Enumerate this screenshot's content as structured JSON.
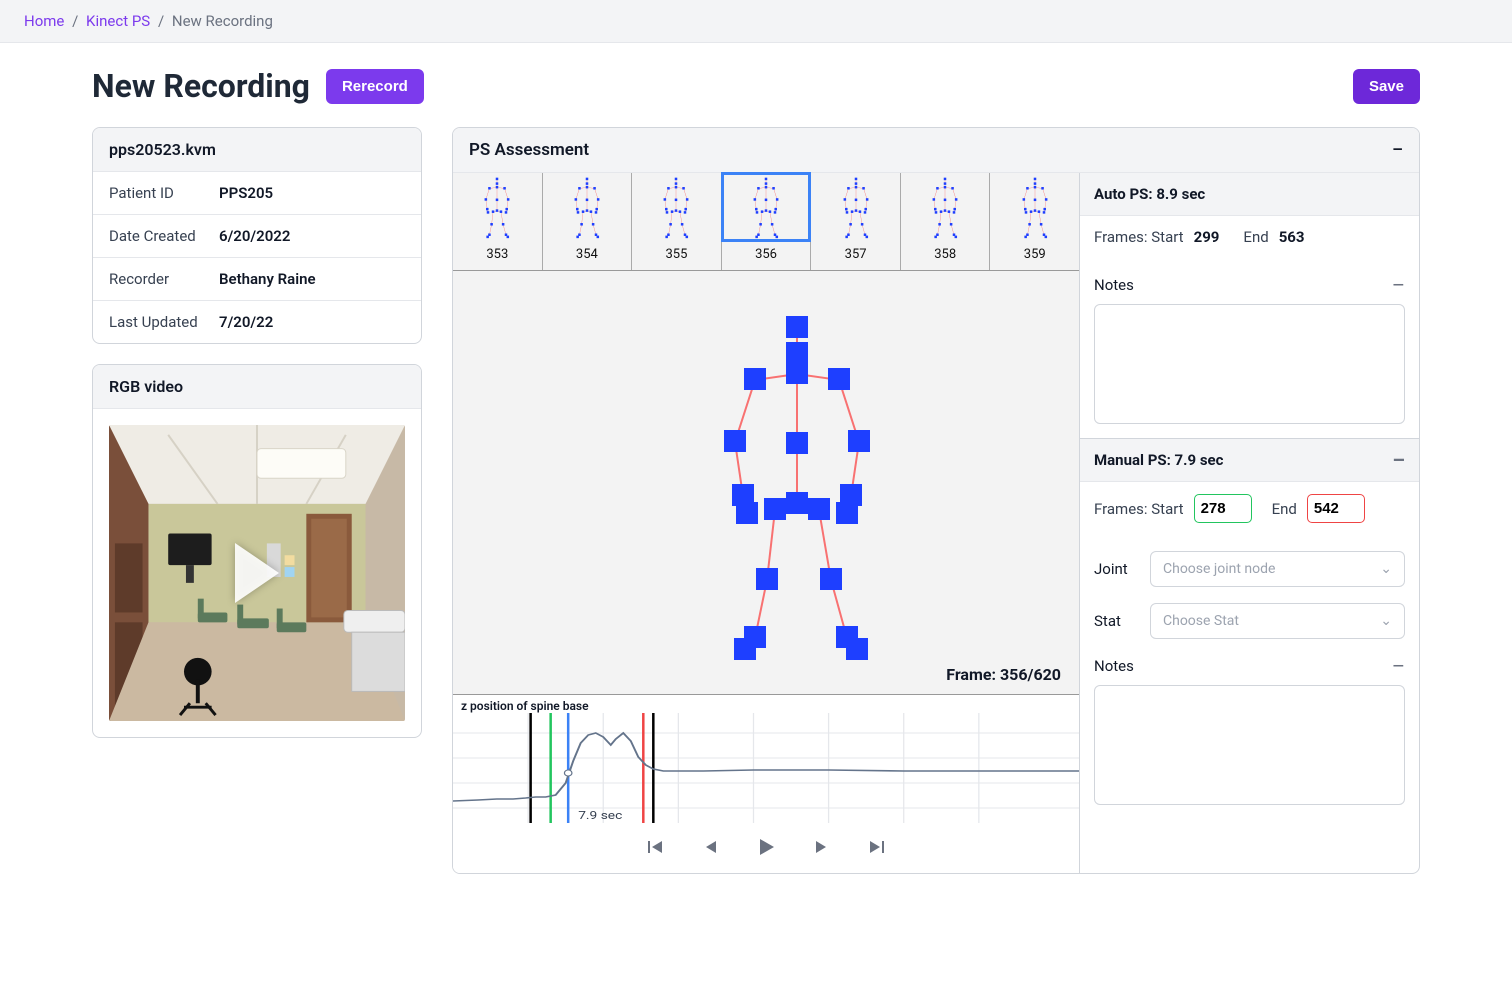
{
  "breadcrumb": {
    "home": "Home",
    "section": "Kinect PS",
    "current": "New Recording"
  },
  "page": {
    "title": "New Recording",
    "rerecord_label": "Rerecord",
    "save_label": "Save"
  },
  "file_card": {
    "filename": "pps20523.kvm",
    "rows": [
      {
        "label": "Patient ID",
        "value": "PPS205"
      },
      {
        "label": "Date Created",
        "value": "6/20/2022"
      },
      {
        "label": "Recorder",
        "value": "Bethany Raine"
      },
      {
        "label": "Last Updated",
        "value": "7/20/22"
      }
    ]
  },
  "video_card": {
    "title": "RGB video"
  },
  "assessment": {
    "title": "PS Assessment",
    "frames": [
      "353",
      "354",
      "355",
      "356",
      "357",
      "358",
      "359"
    ],
    "selected_index": 3,
    "current_frame_label": "Frame: 356/620",
    "plot_title": "z position of spine base",
    "duration_label": "7.9 sec"
  },
  "auto_panel": {
    "title": "Auto PS: 8.9 sec",
    "frames_label": "Frames: Start",
    "start": "299",
    "end_label": "End",
    "end": "563",
    "notes_label": "Notes"
  },
  "manual_panel": {
    "title": "Manual PS: 7.9 sec",
    "frames_label": "Frames: Start",
    "start": "278",
    "end_label": "End",
    "end": "542",
    "joint_label": "Joint",
    "joint_placeholder": "Choose joint node",
    "stat_label": "Stat",
    "stat_placeholder": "Choose Stat",
    "notes_label": "Notes"
  },
  "controls": {
    "skip_back": "skip-back",
    "step_back": "step-back",
    "play": "play",
    "step_fwd": "step-forward",
    "skip_fwd": "skip-forward"
  }
}
